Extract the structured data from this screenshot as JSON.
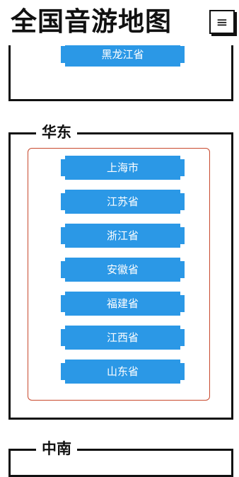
{
  "header": {
    "title": "全国音游地图",
    "menu_icon": "≡"
  },
  "regions": {
    "northeast_partial": {
      "provinces": [
        "黑龙江省"
      ]
    },
    "east": {
      "title": "华东",
      "provinces": [
        "上海市",
        "江苏省",
        "浙江省",
        "安徽省",
        "福建省",
        "江西省",
        "山东省"
      ]
    },
    "central": {
      "title": "中南"
    }
  },
  "colors": {
    "button_bg": "#2b98e6",
    "inner_border": "#c8492d",
    "frame": "#111111"
  }
}
